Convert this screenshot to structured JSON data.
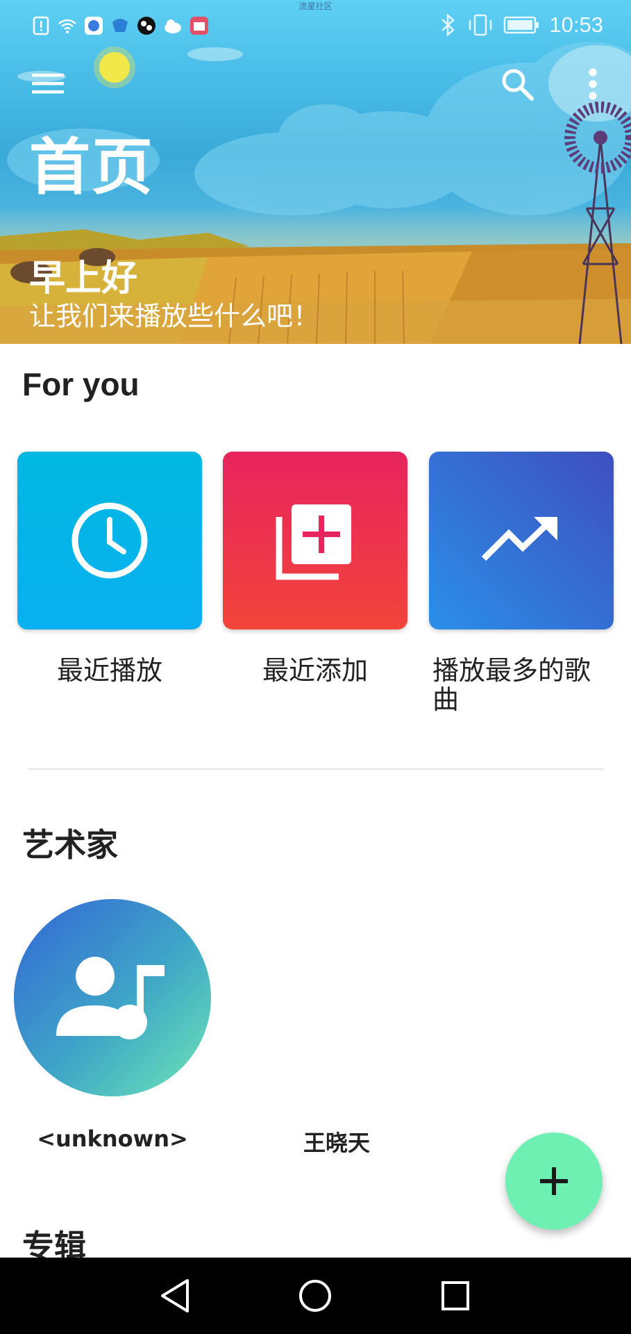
{
  "status_bar": {
    "carrier_text": "流星社区",
    "time": "10:53"
  },
  "header": {
    "title": "首页",
    "greeting": "早上好",
    "greeting_sub": "让我们来播放些什么吧！"
  },
  "sections": {
    "for_you": {
      "title": "For you",
      "tiles": [
        {
          "label": "最近播放",
          "icon": "clock-icon"
        },
        {
          "label": "最近添加",
          "icon": "library-add-icon"
        },
        {
          "label": "播放最多的歌曲",
          "icon": "trending-up-icon"
        }
      ]
    },
    "artists": {
      "title": "艺术家",
      "items": [
        {
          "name": "<unknown>",
          "icon": "artist-music-icon"
        },
        {
          "name": "王晓天"
        }
      ]
    },
    "albums": {
      "title": "专辑"
    }
  },
  "colors": {
    "accent_fab": "#6ff0b3",
    "tile_recent": "#00b8e0",
    "tile_added": "#e8245e",
    "tile_top": "#3f4fbf"
  }
}
